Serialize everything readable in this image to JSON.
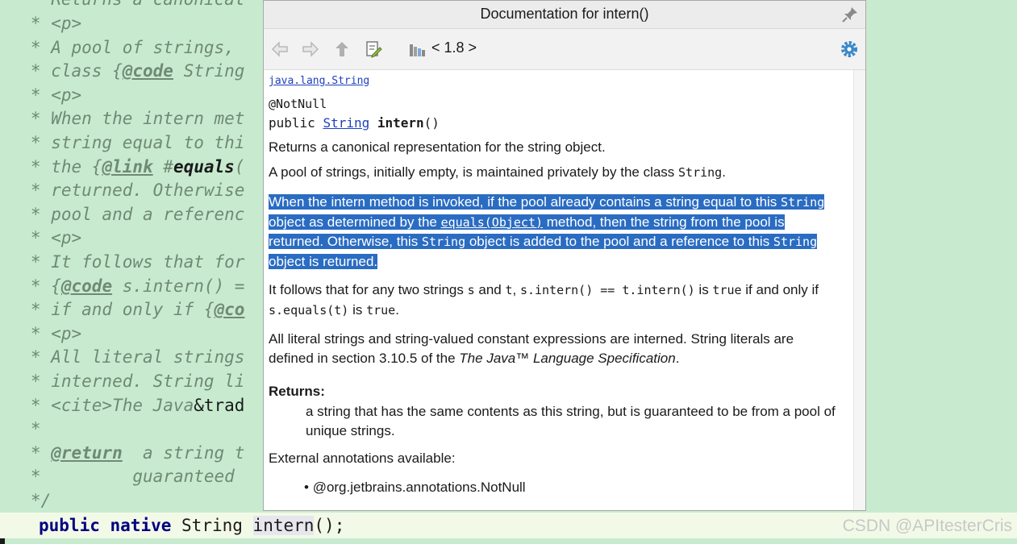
{
  "editor": {
    "lines": [
      {
        "prefix": "   * ",
        "parts": [
          {
            "t": "Returns a canonical",
            "c": "plain"
          }
        ]
      },
      {
        "prefix": "   * ",
        "parts": [
          {
            "t": "<p>",
            "c": "tag"
          }
        ]
      },
      {
        "prefix": "   * ",
        "parts": [
          {
            "t": "A pool of strings,",
            "c": "plain"
          }
        ]
      },
      {
        "prefix": "   * ",
        "parts": [
          {
            "t": "class {",
            "c": "plain"
          },
          {
            "t": "@code",
            "c": "jtag"
          },
          {
            "t": " String",
            "c": "plain"
          }
        ]
      },
      {
        "prefix": "   * ",
        "parts": [
          {
            "t": "<p>",
            "c": "tag"
          }
        ]
      },
      {
        "prefix": "   * ",
        "parts": [
          {
            "t": "When the intern met",
            "c": "plain"
          }
        ]
      },
      {
        "prefix": "   * ",
        "parts": [
          {
            "t": "string equal to thi",
            "c": "plain"
          }
        ]
      },
      {
        "prefix": "   * ",
        "parts": [
          {
            "t": "the {",
            "c": "plain"
          },
          {
            "t": "@link",
            "c": "jtag"
          },
          {
            "t": " #",
            "c": "plain"
          },
          {
            "t": "equals",
            "c": "bold-dark"
          },
          {
            "t": "(",
            "c": "plain"
          }
        ]
      },
      {
        "prefix": "   * ",
        "parts": [
          {
            "t": "returned. Otherwise",
            "c": "plain"
          }
        ]
      },
      {
        "prefix": "   * ",
        "parts": [
          {
            "t": "pool and a referenc",
            "c": "plain"
          }
        ]
      },
      {
        "prefix": "   * ",
        "parts": [
          {
            "t": "<p>",
            "c": "tag"
          }
        ]
      },
      {
        "prefix": "   * ",
        "parts": [
          {
            "t": "It follows that for",
            "c": "plain"
          }
        ]
      },
      {
        "prefix": "   * ",
        "parts": [
          {
            "t": "{",
            "c": "plain"
          },
          {
            "t": "@code",
            "c": "jtag"
          },
          {
            "t": " s.intern() =",
            "c": "plain"
          }
        ]
      },
      {
        "prefix": "   * ",
        "parts": [
          {
            "t": "if and only if {",
            "c": "plain"
          },
          {
            "t": "@co",
            "c": "jtag"
          }
        ]
      },
      {
        "prefix": "   * ",
        "parts": [
          {
            "t": "<p>",
            "c": "tag"
          }
        ]
      },
      {
        "prefix": "   * ",
        "parts": [
          {
            "t": "All literal strings",
            "c": "plain"
          }
        ]
      },
      {
        "prefix": "   * ",
        "parts": [
          {
            "t": "interned. String li",
            "c": "plain"
          }
        ]
      },
      {
        "prefix": "   * ",
        "parts": [
          {
            "t": "<cite>The Java",
            "c": "plain"
          },
          {
            "t": "&trad",
            "c": "dark"
          }
        ]
      },
      {
        "prefix": "   *",
        "parts": []
      },
      {
        "prefix": "   * ",
        "parts": [
          {
            "t": "@return",
            "c": "jtag"
          },
          {
            "t": "  a string t",
            "c": "plain"
          }
        ]
      },
      {
        "prefix": "   *         ",
        "parts": [
          {
            "t": "guaranteed",
            "c": "plain"
          }
        ]
      },
      {
        "prefix": "   */",
        "parts": []
      }
    ],
    "declaration": {
      "kw1": "public",
      "kw2": "native",
      "type": "String",
      "method": "intern",
      "tail": "();"
    }
  },
  "watermark": "CSDN @APItesterCris",
  "popup": {
    "title": "Documentation for intern()",
    "version": "< 1.8 >",
    "package_link": "java.lang.String",
    "annotation": "@NotNull",
    "signature": {
      "modifier": "public",
      "type_link": "String",
      "name": "intern",
      "params": "()"
    },
    "p1": "Returns a canonical representation for the string object.",
    "p2": {
      "text": "A pool of strings, initially empty, is maintained privately by the class ",
      "code": "String",
      "end": "."
    },
    "p3": {
      "a": "When the intern method is invoked, if the pool already contains a string equal to this ",
      "code1": "String",
      "b": " object as determined by the ",
      "link": "equals(Object)",
      "c": " method, then the string from the pool is returned. Otherwise, this ",
      "code2": "String",
      "d": " object is added to the pool and a reference to this ",
      "code3": "String",
      "e": " object is returned."
    },
    "p4": {
      "a": "It follows that for any two strings ",
      "s": "s",
      "and": " and ",
      "t": "t",
      "comma": ", ",
      "expr": "s.intern() == t.intern()",
      "is": " is ",
      "true1": "true",
      "iff": " if and only if ",
      "eq": "s.equals(t)",
      "is2": " is ",
      "true2": "true",
      "end": "."
    },
    "p5": {
      "a": "All literal strings and string-valued constant expressions are interned. String literals are defined in section 3.10.5 of the ",
      "cite": "The Java™ Language Specification",
      "end": "."
    },
    "returns_label": "Returns:",
    "returns_text": "a string that has the same contents as this string, but is guaranteed to be from a pool of unique strings.",
    "external_label": "External annotations available:",
    "external_item": "@org.jetbrains.annotations.NotNull"
  },
  "colors": {
    "editor_bg": "#c8ebd0",
    "selection": "#2a6cc2",
    "link": "#1f3fbf"
  }
}
